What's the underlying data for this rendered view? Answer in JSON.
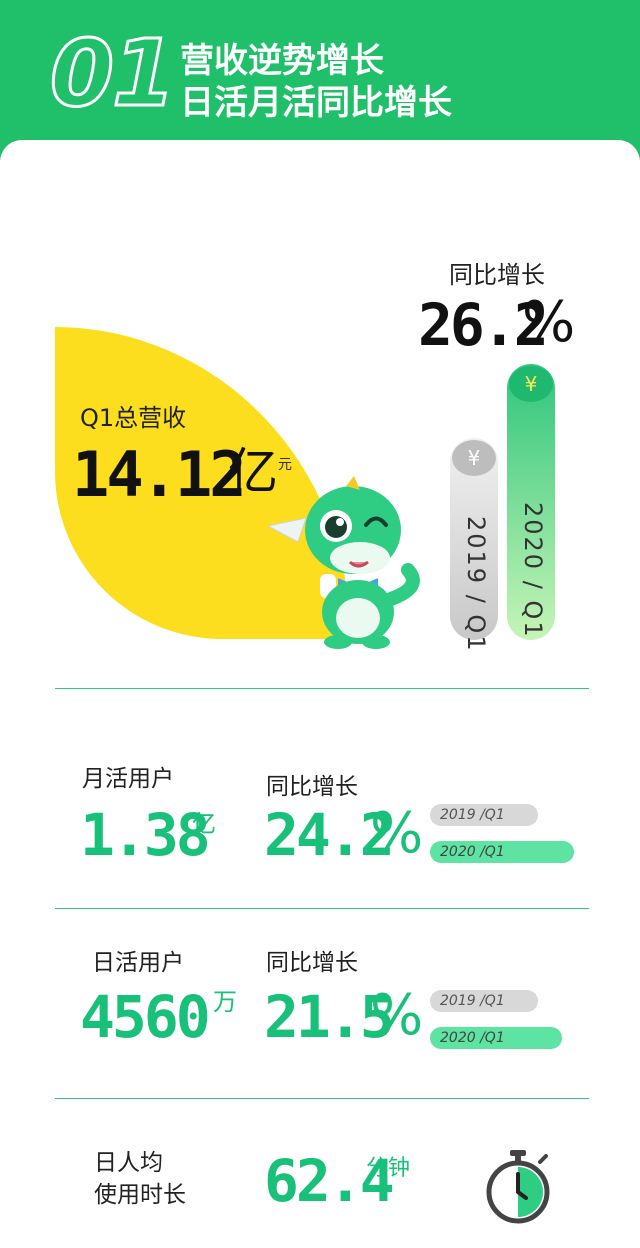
{
  "header": {
    "number": "01",
    "line1": "营收逆势增长",
    "line2": "日活月活同比增长"
  },
  "revenue": {
    "label": "Q1总营收",
    "value": "14.12",
    "unit_big": "亿",
    "unit_small": "元"
  },
  "growth": {
    "label": "同比增长",
    "value": "26.2",
    "percent": "%"
  },
  "pillars": {
    "prev": "2019 / Q1",
    "curr": "2020 / Q1",
    "coin_symbol": "¥"
  },
  "mau": {
    "label": "月活用户",
    "value": "1.38",
    "unit": "亿",
    "growth_label": "同比增长",
    "growth_value": "24.2",
    "percent": "%",
    "bar_prev": "2019 /Q1",
    "bar_curr": "2020 /Q1"
  },
  "dau": {
    "label": "日活用户",
    "value": "4560",
    "unit": "万",
    "growth_label": "同比增长",
    "growth_value": "21.5",
    "percent": "%",
    "bar_prev": "2019 /Q1",
    "bar_curr": "2020 /Q1"
  },
  "usage": {
    "label_line1": "日人均",
    "label_line2": "使用时长",
    "value": "62.4",
    "unit": "分钟"
  },
  "colors": {
    "brand_green": "#20c06a",
    "accent_yellow": "#fdde1e",
    "text_green": "#18c07a"
  }
}
